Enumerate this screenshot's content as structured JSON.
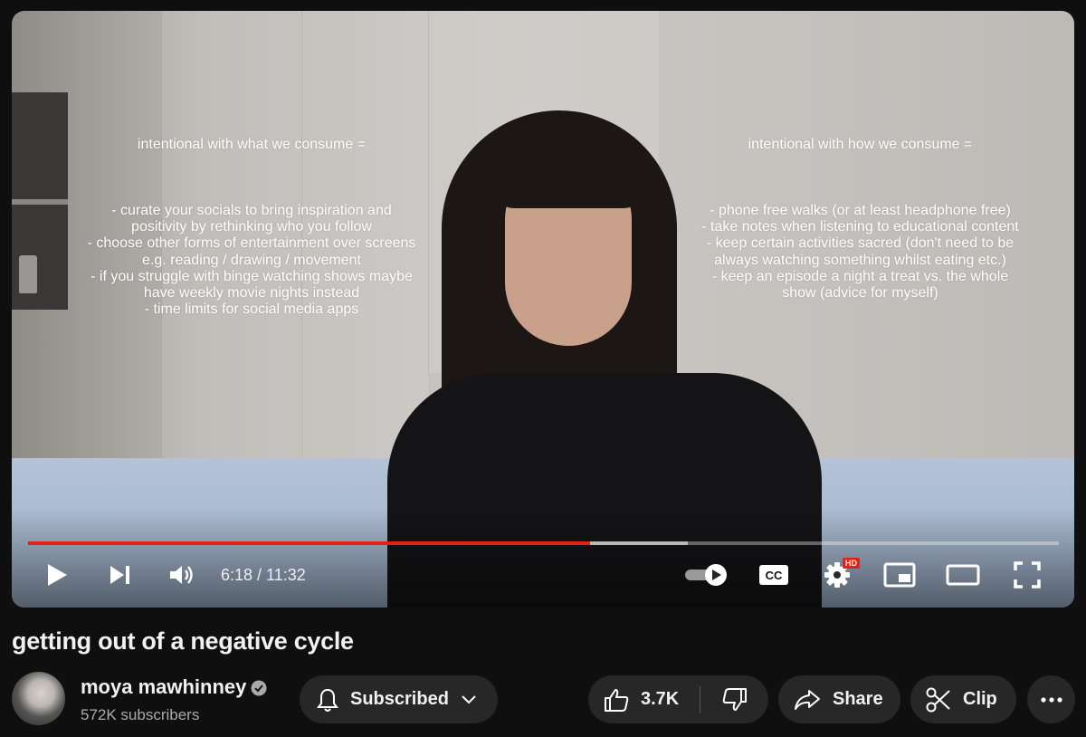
{
  "video": {
    "overlay_left_heading": "intentional with what we consume =",
    "overlay_left_body": "- curate your socials to bring inspiration and\npositivity by rethinking who you follow\n- choose other forms of entertainment over screens\ne.g. reading / drawing / movement\n- if you struggle with binge watching shows maybe\nhave weekly movie nights instead\n- time limits for social media apps",
    "overlay_right_heading": "intentional with how we consume =",
    "overlay_right_body": "- phone free walks (or at least headphone free)\n- take notes when listening to educational content\n- keep certain activities sacred (don't need to be\nalways watching something whilst eating etc.)\n- keep an episode a night a treat vs. the whole\nshow (advice for myself)",
    "time": "6:18 / 11:32",
    "played_fraction": 0.545,
    "buffered_fraction": 0.64,
    "quality_badge": "HD",
    "accent_color": "#e22214"
  },
  "controls": {
    "play_icon": "play-icon",
    "next_icon": "next-icon",
    "volume_icon": "volume-icon",
    "autoplay_icon": "autoplay-toggle-icon",
    "captions_icon": "captions-icon",
    "settings_icon": "gear-icon",
    "miniplayer_icon": "miniplayer-icon",
    "theater_icon": "theater-mode-icon",
    "fullscreen_icon": "fullscreen-icon"
  },
  "title": "getting out of a negative cycle",
  "channel": {
    "name": "moya mawhinney",
    "subscribers": "572K subscribers",
    "verified": true
  },
  "actions": {
    "subscribed_label": "Subscribed",
    "like_count": "3.7K",
    "share_label": "Share",
    "clip_label": "Clip"
  }
}
